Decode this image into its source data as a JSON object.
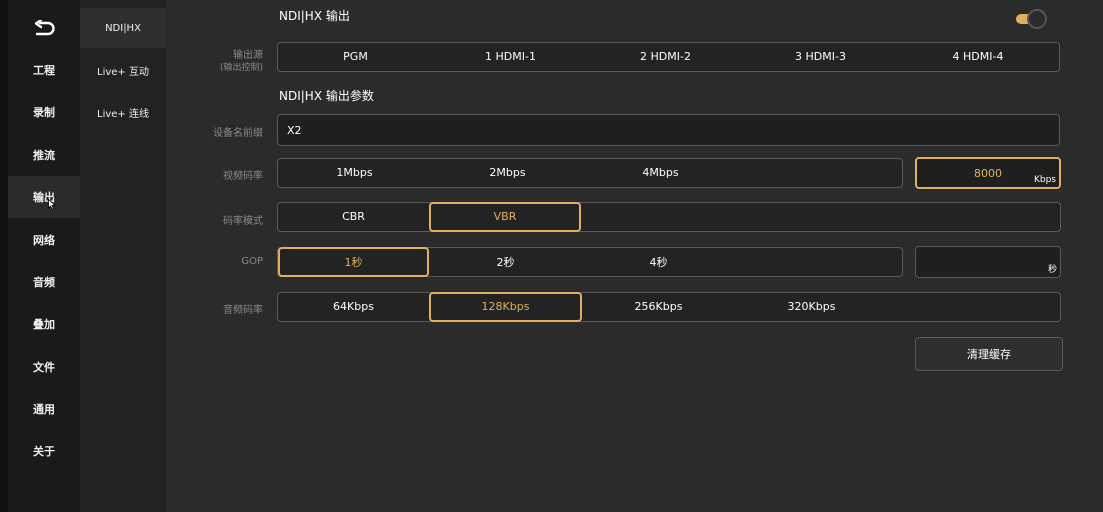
{
  "nav": {
    "items": [
      {
        "label": "工程"
      },
      {
        "label": "录制"
      },
      {
        "label": "推流"
      },
      {
        "label": "输出"
      },
      {
        "label": "网络"
      },
      {
        "label": "音频"
      },
      {
        "label": "叠加"
      },
      {
        "label": "文件"
      },
      {
        "label": "通用"
      },
      {
        "label": "关于"
      }
    ],
    "active": "输出"
  },
  "subnav": {
    "items": [
      {
        "label": "NDI|HX"
      },
      {
        "label": "Live+ 互动"
      },
      {
        "label": "Live+ 连线"
      }
    ],
    "active": "NDI|HX"
  },
  "ndi": {
    "title": "NDI|HX 输出",
    "enabled": true,
    "output_source": {
      "label": "输出源",
      "sublabel": "(输出控制)",
      "options": [
        "PGM",
        "1 HDMI-1",
        "2 HDMI-2",
        "3 HDMI-3",
        "4 HDMI-4"
      ]
    },
    "params_title": "NDI|HX 输出参数",
    "device_prefix": {
      "label": "设备名前缀",
      "value": "X2"
    },
    "video_bitrate": {
      "label": "视频码率",
      "options": [
        "1Mbps",
        "2Mbps",
        "4Mbps"
      ],
      "custom_value": "8000",
      "custom_unit": "Kbps",
      "selected": "custom"
    },
    "bitrate_mode": {
      "label": "码率模式",
      "options": [
        "CBR",
        "VBR"
      ],
      "selected": "VBR"
    },
    "gop": {
      "label": "GOP",
      "options": [
        "1秒",
        "2秒",
        "4秒"
      ],
      "selected": "1秒",
      "custom_value": "",
      "custom_unit": "秒"
    },
    "audio_bitrate": {
      "label": "音频码率",
      "options": [
        "64Kbps",
        "128Kbps",
        "256Kbps",
        "320Kbps"
      ],
      "selected": "128Kbps"
    },
    "clear_cache_label": "清理缓存"
  },
  "colors": {
    "accent": "#e0b062",
    "background": "#2b2b2b",
    "nav_bg": "#1a1a1a"
  }
}
